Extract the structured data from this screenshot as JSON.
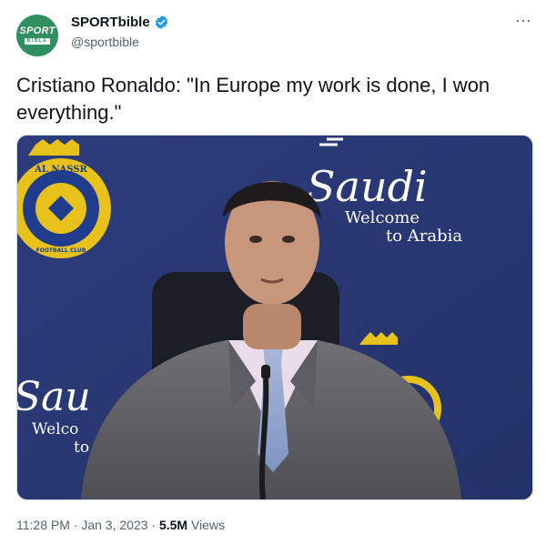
{
  "account": {
    "avatar_line1": "SPORT",
    "avatar_line2": "BIBLE",
    "name": "SPORTbible",
    "handle": "@sportbible"
  },
  "more_label": "···",
  "tweet": {
    "text": "Cristiano Ronaldo: \"In Europe my work is done, I won everything.\""
  },
  "media": {
    "club_badge_text": "AL NASSR",
    "club_badge_subtext": "FOOTBALL CLUB",
    "backdrop_brand": "Saudi",
    "backdrop_line1": "Welcome",
    "backdrop_line2": "to Arabia",
    "backdrop_brand_partial": "Sau",
    "backdrop_line1_partial": "Welco",
    "backdrop_line2_partial": "to"
  },
  "meta": {
    "time": "11:28 PM",
    "sep1": " · ",
    "date": "Jan 3, 2023",
    "sep2": " · ",
    "views_count": "5.5M",
    "views_label": " Views"
  },
  "colors": {
    "brand_green": "#2f8f5f",
    "verified_blue": "#1d9bf0",
    "backdrop_blue": "#2a3a78",
    "badge_gold": "#e8c21a"
  }
}
